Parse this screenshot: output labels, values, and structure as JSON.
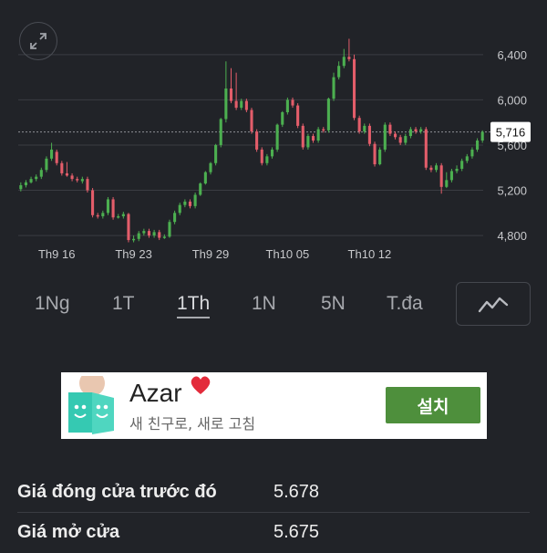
{
  "chart_data": {
    "type": "candlestick",
    "y_ticks": [
      "6,400",
      "6,000",
      "5,600",
      "5,200",
      "4,800"
    ],
    "y_tick_values": [
      6400,
      6000,
      5600,
      5200,
      4800
    ],
    "ylim": [
      4720,
      6560
    ],
    "x_ticks": [
      "Th9 16",
      "Th9 23",
      "Th9 29",
      "Th10 05",
      "Th10 12"
    ],
    "x_tick_index": [
      7,
      22,
      37,
      52,
      68
    ],
    "current_price_label": "5,716",
    "current_price": 5716,
    "up_color": "#4caf50",
    "down_color": "#e35d6a",
    "candles": [
      [
        5210,
        5245,
        5190,
        5270
      ],
      [
        5245,
        5270,
        5225,
        5290
      ],
      [
        5270,
        5300,
        5260,
        5320
      ],
      [
        5300,
        5320,
        5280,
        5340
      ],
      [
        5320,
        5380,
        5300,
        5400
      ],
      [
        5380,
        5480,
        5360,
        5500
      ],
      [
        5480,
        5560,
        5460,
        5620
      ],
      [
        5540,
        5440,
        5420,
        5560
      ],
      [
        5440,
        5350,
        5330,
        5460
      ],
      [
        5350,
        5330,
        5320,
        5450
      ],
      [
        5330,
        5300,
        5280,
        5350
      ],
      [
        5300,
        5290,
        5270,
        5320
      ],
      [
        5280,
        5300,
        5260,
        5320
      ],
      [
        5300,
        5200,
        5180,
        5320
      ],
      [
        5200,
        4980,
        4960,
        5220
      ],
      [
        4980,
        4970,
        4950,
        5000
      ],
      [
        4970,
        5000,
        4950,
        5020
      ],
      [
        5000,
        5120,
        4980,
        5140
      ],
      [
        5120,
        4960,
        4940,
        5140
      ],
      [
        4960,
        4970,
        4950,
        4990
      ],
      [
        4970,
        4990,
        4950,
        5010
      ],
      [
        4990,
        4760,
        4740,
        5000
      ],
      [
        4760,
        4770,
        4740,
        4800
      ],
      [
        4770,
        4820,
        4750,
        4840
      ],
      [
        4820,
        4840,
        4800,
        4860
      ],
      [
        4840,
        4800,
        4780,
        4860
      ],
      [
        4800,
        4830,
        4780,
        4850
      ],
      [
        4830,
        4780,
        4760,
        4850
      ],
      [
        4780,
        4790,
        4770,
        4810
      ],
      [
        4790,
        4920,
        4780,
        4940
      ],
      [
        4920,
        5000,
        4900,
        5020
      ],
      [
        5000,
        5070,
        4980,
        5090
      ],
      [
        5070,
        5100,
        5050,
        5120
      ],
      [
        5100,
        5060,
        5040,
        5120
      ],
      [
        5060,
        5160,
        5040,
        5180
      ],
      [
        5160,
        5260,
        5150,
        5270
      ],
      [
        5260,
        5360,
        5250,
        5370
      ],
      [
        5360,
        5440,
        5340,
        5450
      ],
      [
        5440,
        5600,
        5420,
        5610
      ],
      [
        5600,
        5830,
        5580,
        5840
      ],
      [
        5830,
        6100,
        5800,
        6340
      ],
      [
        6100,
        5990,
        5970,
        6280
      ],
      [
        5990,
        5930,
        5910,
        6240
      ],
      [
        5930,
        5990,
        5910,
        6010
      ],
      [
        5990,
        5910,
        5890,
        6010
      ],
      [
        5910,
        5720,
        5700,
        5930
      ],
      [
        5720,
        5560,
        5540,
        5740
      ],
      [
        5560,
        5440,
        5420,
        5580
      ],
      [
        5440,
        5500,
        5420,
        5520
      ],
      [
        5500,
        5560,
        5480,
        5580
      ],
      [
        5560,
        5780,
        5540,
        5790
      ],
      [
        5780,
        5890,
        5760,
        5900
      ],
      [
        5890,
        6000,
        5870,
        6020
      ],
      [
        6000,
        5950,
        5930,
        6020
      ],
      [
        5950,
        5770,
        5750,
        5970
      ],
      [
        5770,
        5580,
        5560,
        5790
      ],
      [
        5580,
        5680,
        5560,
        5700
      ],
      [
        5680,
        5640,
        5620,
        5700
      ],
      [
        5640,
        5740,
        5620,
        5760
      ],
      [
        5740,
        5730,
        5710,
        5760
      ],
      [
        5730,
        6010,
        5710,
        6020
      ],
      [
        6010,
        6200,
        5990,
        6240
      ],
      [
        6200,
        6300,
        6180,
        6340
      ],
      [
        6300,
        6380,
        6280,
        6450
      ],
      [
        6380,
        6360,
        6340,
        6540
      ],
      [
        6360,
        5840,
        5820,
        6400
      ],
      [
        5840,
        5720,
        5700,
        5860
      ],
      [
        5720,
        5770,
        5700,
        5790
      ],
      [
        5770,
        5610,
        5590,
        5790
      ],
      [
        5610,
        5430,
        5410,
        5630
      ],
      [
        5430,
        5560,
        5420,
        5580
      ],
      [
        5560,
        5780,
        5540,
        5800
      ],
      [
        5780,
        5700,
        5680,
        5800
      ],
      [
        5700,
        5670,
        5650,
        5720
      ],
      [
        5670,
        5620,
        5600,
        5690
      ],
      [
        5620,
        5680,
        5600,
        5700
      ],
      [
        5680,
        5740,
        5660,
        5760
      ],
      [
        5740,
        5720,
        5700,
        5760
      ],
      [
        5720,
        5740,
        5700,
        5760
      ],
      [
        5740,
        5400,
        5380,
        5760
      ],
      [
        5400,
        5380,
        5360,
        5420
      ],
      [
        5380,
        5420,
        5360,
        5440
      ],
      [
        5420,
        5230,
        5170,
        5440
      ],
      [
        5230,
        5290,
        5220,
        5360
      ],
      [
        5290,
        5370,
        5270,
        5390
      ],
      [
        5370,
        5390,
        5350,
        5420
      ],
      [
        5390,
        5460,
        5370,
        5480
      ],
      [
        5460,
        5500,
        5440,
        5520
      ],
      [
        5500,
        5560,
        5480,
        5580
      ],
      [
        5560,
        5640,
        5540,
        5660
      ],
      [
        5640,
        5716,
        5620,
        5730
      ]
    ]
  },
  "range_tabs": {
    "day": "1Ng",
    "week": "1T",
    "month": "1Th",
    "year": "1N",
    "five_year": "5N",
    "max": "T.đa"
  },
  "ad": {
    "title": "Azar",
    "subtitle": "새 친구로, 새로 고침",
    "install": "설치"
  },
  "stats": [
    {
      "label": "Giá đóng cửa trước đó",
      "value": "5.678"
    },
    {
      "label": "Giá mở cửa",
      "value": "5.675"
    }
  ]
}
